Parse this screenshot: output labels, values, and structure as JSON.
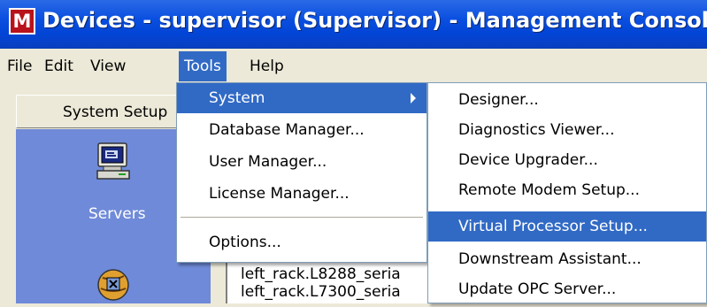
{
  "window": {
    "title": "Devices - supervisor (Supervisor) - Management Console",
    "app_icon_letter": "M"
  },
  "menubar": {
    "items": [
      {
        "label": "File"
      },
      {
        "label": "Edit"
      },
      {
        "label": "View"
      },
      {
        "label": "Tools"
      },
      {
        "label": "Help"
      }
    ],
    "active": "Tools"
  },
  "left_panel": {
    "header": "System Setup",
    "items": [
      {
        "label": "Servers",
        "icon": "computer-icon"
      },
      {
        "label": "",
        "icon": "globe-icon"
      }
    ]
  },
  "content": {
    "items": [
      "left_rack.L8288_seria",
      "left_rack.L7300_seria"
    ]
  },
  "tools_menu": {
    "items": [
      {
        "label": "System",
        "submenu": true,
        "highlighted": true
      },
      {
        "label": "Database Manager..."
      },
      {
        "label": "User Manager..."
      },
      {
        "label": "License Manager..."
      },
      {
        "label": "Options..."
      }
    ]
  },
  "system_submenu": {
    "items": [
      {
        "label": "Designer..."
      },
      {
        "label": "Diagnostics Viewer..."
      },
      {
        "label": "Device Upgrader..."
      },
      {
        "label": "Remote Modem Setup..."
      },
      {
        "label": "Virtual Processor Setup...",
        "highlighted": true
      },
      {
        "label": "Downstream Assistant..."
      },
      {
        "label": "Update OPC Server..."
      }
    ]
  },
  "colors": {
    "titlebar": "#0a4fe0",
    "highlight": "#316ac5",
    "left_panel_blue": "#6f8ad8"
  }
}
